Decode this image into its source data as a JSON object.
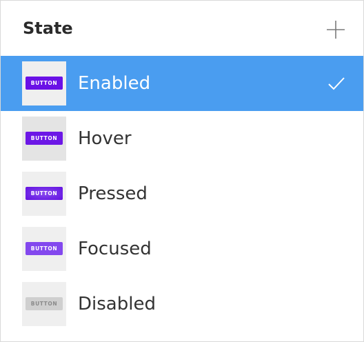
{
  "panel": {
    "title": "State",
    "add_icon": "plus-icon"
  },
  "states": [
    {
      "label": "Enabled",
      "button_text": "BUTTON",
      "selected": true
    },
    {
      "label": "Hover",
      "button_text": "BUTTON",
      "selected": false
    },
    {
      "label": "Pressed",
      "button_text": "BUTTON",
      "selected": false
    },
    {
      "label": "Focused",
      "button_text": "BUTTON",
      "selected": false
    },
    {
      "label": "Disabled",
      "button_text": "BUTTON",
      "selected": false
    }
  ],
  "colors": {
    "selection": "#4a9df0",
    "button_primary": "#6a11e6",
    "button_focused": "#8348ee",
    "button_disabled": "#cfcfcf"
  },
  "icons": {
    "selected_marker": "checkmark-icon"
  }
}
